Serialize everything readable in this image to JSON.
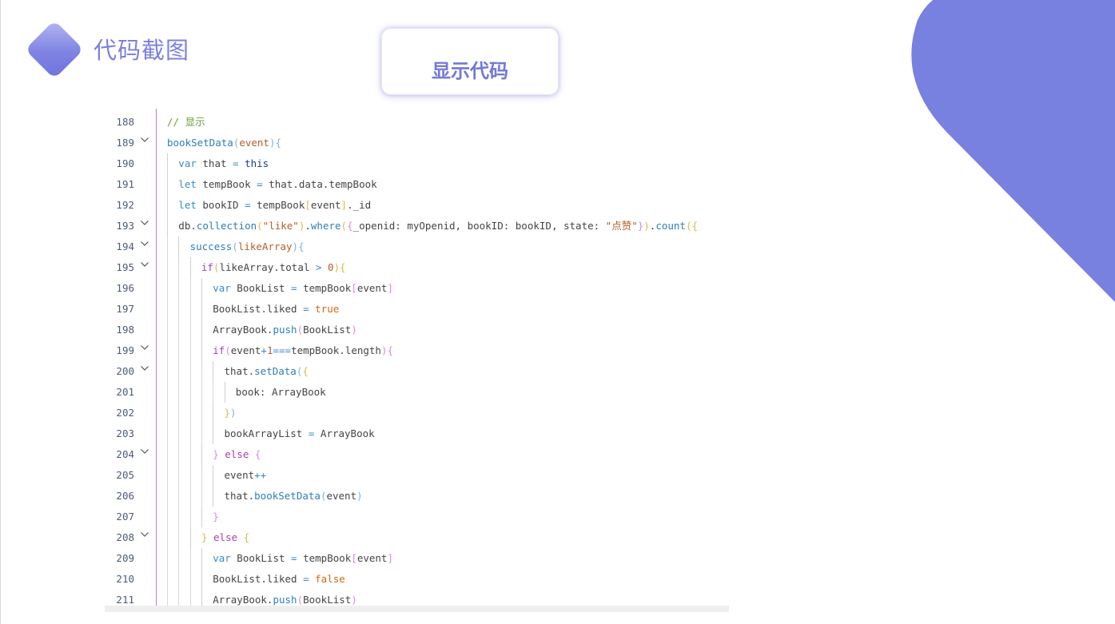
{
  "header": {
    "title": "代码截图",
    "show_code_button": "显示代码"
  },
  "colors": {
    "accent": "#7d80df",
    "corner_shape": "#7880e0",
    "line_number": "#4b5b7a",
    "comment": "#6f9a35",
    "function": "#2f7dba",
    "keyword": "#a640b3",
    "string": "#b2602a"
  },
  "icons": {
    "logo": "diamond-logo-icon",
    "fold": "chevron-down-icon"
  },
  "editor": {
    "lines": [
      {
        "num": "188",
        "fold": false,
        "indent": 0,
        "tokens": [
          [
            "c-comment",
            "// 显示"
          ]
        ]
      },
      {
        "num": "189",
        "fold": true,
        "indent": 0,
        "tokens": [
          [
            "c-func",
            "bookSetData"
          ],
          [
            "c-brk3",
            "("
          ],
          [
            "c-param",
            "event"
          ],
          [
            "c-brk3",
            ")"
          ],
          [
            "c-brk3",
            "{"
          ]
        ]
      },
      {
        "num": "190",
        "fold": false,
        "indent": 1,
        "tokens": [
          [
            "c-op",
            "var"
          ],
          [
            "c-plain",
            " that "
          ],
          [
            "c-op",
            "="
          ],
          [
            "c-plain",
            " "
          ],
          [
            "c-this",
            "this"
          ]
        ]
      },
      {
        "num": "191",
        "fold": false,
        "indent": 1,
        "tokens": [
          [
            "c-op",
            "let"
          ],
          [
            "c-plain",
            " tempBook "
          ],
          [
            "c-op",
            "="
          ],
          [
            "c-plain",
            " that.data.tempBook"
          ]
        ]
      },
      {
        "num": "192",
        "fold": false,
        "indent": 1,
        "tokens": [
          [
            "c-op",
            "let"
          ],
          [
            "c-plain",
            " bookID "
          ],
          [
            "c-op",
            "="
          ],
          [
            "c-plain",
            " tempBook"
          ],
          [
            "c-brk2",
            "["
          ],
          [
            "c-plain",
            "event"
          ],
          [
            "c-brk2",
            "]"
          ],
          [
            "c-plain",
            "._id"
          ]
        ]
      },
      {
        "num": "193",
        "fold": true,
        "indent": 1,
        "tokens": [
          [
            "c-plain",
            "db."
          ],
          [
            "c-func",
            "collection"
          ],
          [
            "c-brk2",
            "("
          ],
          [
            "c-str",
            "\"like\""
          ],
          [
            "c-brk2",
            ")"
          ],
          [
            "c-plain",
            "."
          ],
          [
            "c-func",
            "where"
          ],
          [
            "c-brk2",
            "("
          ],
          [
            "c-brk",
            "{"
          ],
          [
            "c-plain",
            "_openid: myOpenid, bookID: bookID, state: "
          ],
          [
            "c-str",
            "\"点赞\""
          ],
          [
            "c-brk",
            "}"
          ],
          [
            "c-brk2",
            ")"
          ],
          [
            "c-plain",
            "."
          ],
          [
            "c-func",
            "count"
          ],
          [
            "c-brk2",
            "("
          ],
          [
            "c-brk2",
            "{"
          ]
        ]
      },
      {
        "num": "194",
        "fold": true,
        "indent": 2,
        "tokens": [
          [
            "c-func",
            "success"
          ],
          [
            "c-brk3",
            "("
          ],
          [
            "c-param",
            "likeArray"
          ],
          [
            "c-brk3",
            ")"
          ],
          [
            "c-brk3",
            "{"
          ]
        ]
      },
      {
        "num": "195",
        "fold": true,
        "indent": 3,
        "tokens": [
          [
            "c-kw",
            "if"
          ],
          [
            "c-brk2",
            "("
          ],
          [
            "c-plain",
            "likeArray.total "
          ],
          [
            "c-op",
            ">"
          ],
          [
            "c-plain",
            " "
          ],
          [
            "c-num",
            "0"
          ],
          [
            "c-brk2",
            ")"
          ],
          [
            "c-brk2",
            "{"
          ]
        ]
      },
      {
        "num": "196",
        "fold": false,
        "indent": 4,
        "tokens": [
          [
            "c-op",
            "var"
          ],
          [
            "c-plain",
            " BookList "
          ],
          [
            "c-op",
            "="
          ],
          [
            "c-plain",
            " tempBook"
          ],
          [
            "c-brk",
            "["
          ],
          [
            "c-plain",
            "event"
          ],
          [
            "c-brk",
            "]"
          ]
        ]
      },
      {
        "num": "197",
        "fold": false,
        "indent": 4,
        "tokens": [
          [
            "c-plain",
            "BookList.liked "
          ],
          [
            "c-op",
            "="
          ],
          [
            "c-plain",
            " "
          ],
          [
            "c-bool",
            "true"
          ]
        ]
      },
      {
        "num": "198",
        "fold": false,
        "indent": 4,
        "tokens": [
          [
            "c-plain",
            "ArrayBook."
          ],
          [
            "c-func",
            "push"
          ],
          [
            "c-brk",
            "("
          ],
          [
            "c-plain",
            "BookList"
          ],
          [
            "c-brk",
            ")"
          ]
        ]
      },
      {
        "num": "199",
        "fold": true,
        "indent": 4,
        "tokens": [
          [
            "c-kw",
            "if"
          ],
          [
            "c-brk",
            "("
          ],
          [
            "c-plain",
            "event"
          ],
          [
            "c-op",
            "+"
          ],
          [
            "c-num",
            "1"
          ],
          [
            "c-op",
            "==="
          ],
          [
            "c-plain",
            "tempBook.length"
          ],
          [
            "c-brk",
            ")"
          ],
          [
            "c-brk",
            "{"
          ]
        ]
      },
      {
        "num": "200",
        "fold": true,
        "indent": 5,
        "tokens": [
          [
            "c-plain",
            "that."
          ],
          [
            "c-func",
            "setData"
          ],
          [
            "c-brk3",
            "("
          ],
          [
            "c-brk2",
            "{"
          ]
        ]
      },
      {
        "num": "201",
        "fold": false,
        "indent": 6,
        "tokens": [
          [
            "c-plain",
            "book: ArrayBook"
          ]
        ]
      },
      {
        "num": "202",
        "fold": false,
        "indent": 5,
        "tokens": [
          [
            "c-brk2",
            "}"
          ],
          [
            "c-brk3",
            ")"
          ]
        ]
      },
      {
        "num": "203",
        "fold": false,
        "indent": 5,
        "tokens": [
          [
            "c-plain",
            "bookArrayList "
          ],
          [
            "c-op",
            "="
          ],
          [
            "c-plain",
            " ArrayBook"
          ]
        ]
      },
      {
        "num": "204",
        "fold": true,
        "indent": 4,
        "tokens": [
          [
            "c-brk",
            "}"
          ],
          [
            "c-plain",
            " "
          ],
          [
            "c-kw",
            "else"
          ],
          [
            "c-plain",
            " "
          ],
          [
            "c-brk",
            "{"
          ]
        ]
      },
      {
        "num": "205",
        "fold": false,
        "indent": 5,
        "tokens": [
          [
            "c-plain",
            "event"
          ],
          [
            "c-op",
            "++"
          ]
        ]
      },
      {
        "num": "206",
        "fold": false,
        "indent": 5,
        "tokens": [
          [
            "c-plain",
            "that."
          ],
          [
            "c-func",
            "bookSetData"
          ],
          [
            "c-brk3",
            "("
          ],
          [
            "c-plain",
            "event"
          ],
          [
            "c-brk3",
            ")"
          ]
        ]
      },
      {
        "num": "207",
        "fold": false,
        "indent": 4,
        "tokens": [
          [
            "c-brk",
            "}"
          ]
        ]
      },
      {
        "num": "208",
        "fold": true,
        "indent": 3,
        "tokens": [
          [
            "c-brk2",
            "}"
          ],
          [
            "c-plain",
            " "
          ],
          [
            "c-kw",
            "else"
          ],
          [
            "c-plain",
            " "
          ],
          [
            "c-brk2",
            "{"
          ]
        ]
      },
      {
        "num": "209",
        "fold": false,
        "indent": 4,
        "tokens": [
          [
            "c-op",
            "var"
          ],
          [
            "c-plain",
            " BookList "
          ],
          [
            "c-op",
            "="
          ],
          [
            "c-plain",
            " tempBook"
          ],
          [
            "c-brk",
            "["
          ],
          [
            "c-plain",
            "event"
          ],
          [
            "c-brk",
            "]"
          ]
        ]
      },
      {
        "num": "210",
        "fold": false,
        "indent": 4,
        "tokens": [
          [
            "c-plain",
            "BookList.liked "
          ],
          [
            "c-op",
            "="
          ],
          [
            "c-plain",
            " "
          ],
          [
            "c-bool",
            "false"
          ]
        ]
      },
      {
        "num": "211",
        "fold": false,
        "indent": 4,
        "tokens": [
          [
            "c-plain",
            "ArrayBook."
          ],
          [
            "c-func",
            "push"
          ],
          [
            "c-brk",
            "("
          ],
          [
            "c-plain",
            "BookList"
          ],
          [
            "c-brk",
            ")"
          ]
        ]
      }
    ]
  }
}
